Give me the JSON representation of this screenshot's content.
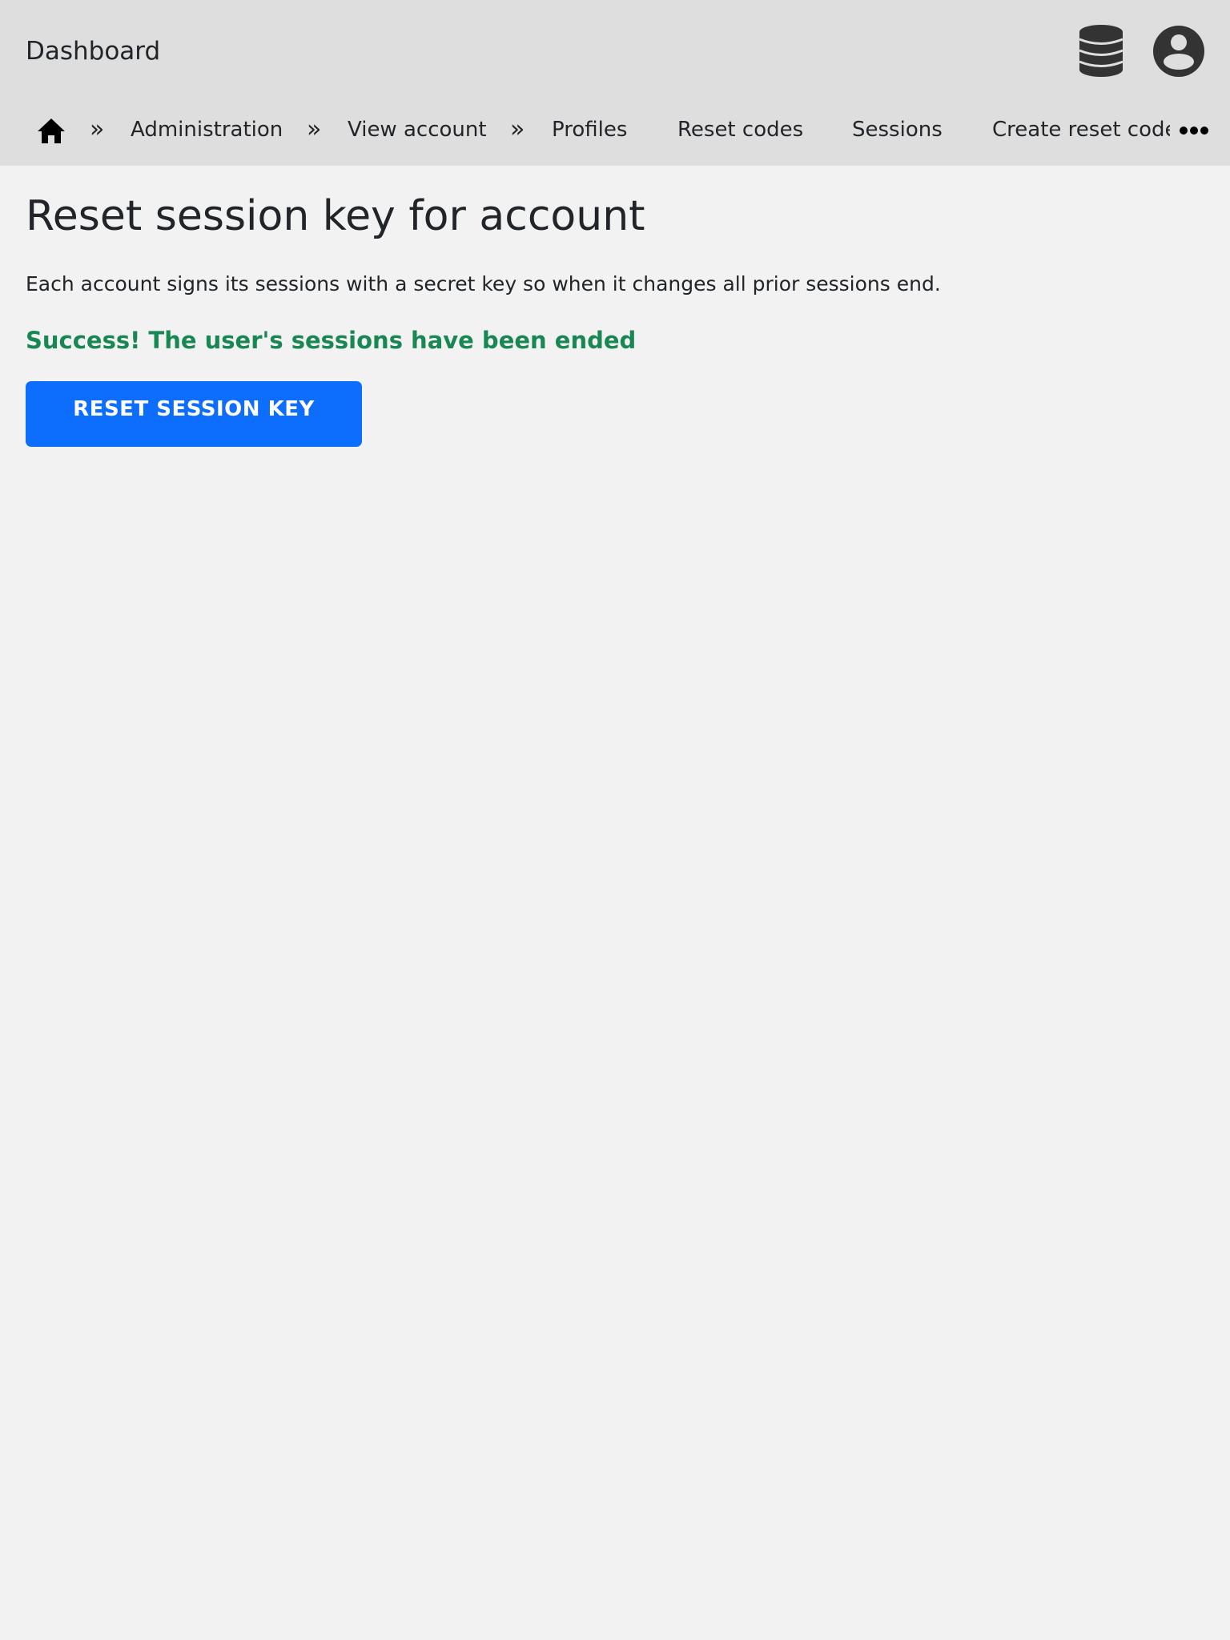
{
  "header": {
    "title": "Dashboard",
    "icons": [
      "database-icon",
      "user-circle-icon"
    ]
  },
  "nav": {
    "home_icon": "home-icon",
    "separator": "»",
    "breadcrumbs": [
      "Administration",
      "View account"
    ],
    "tabs": [
      "Profiles",
      "Reset codes",
      "Sessions",
      "Create reset code"
    ],
    "more_icon": "more-horizontal-icon"
  },
  "main": {
    "title": "Reset session key for account",
    "description": "Each account signs its sessions with a secret key so when it changes all prior sessions end.",
    "success_message": "Success! The user's sessions have been ended",
    "button_label": "RESET SESSION KEY"
  },
  "colors": {
    "header_bg": "#dedede",
    "page_bg": "#f2f2f2",
    "success": "#198754",
    "button": "#0d6efd",
    "icon": "#333333"
  }
}
